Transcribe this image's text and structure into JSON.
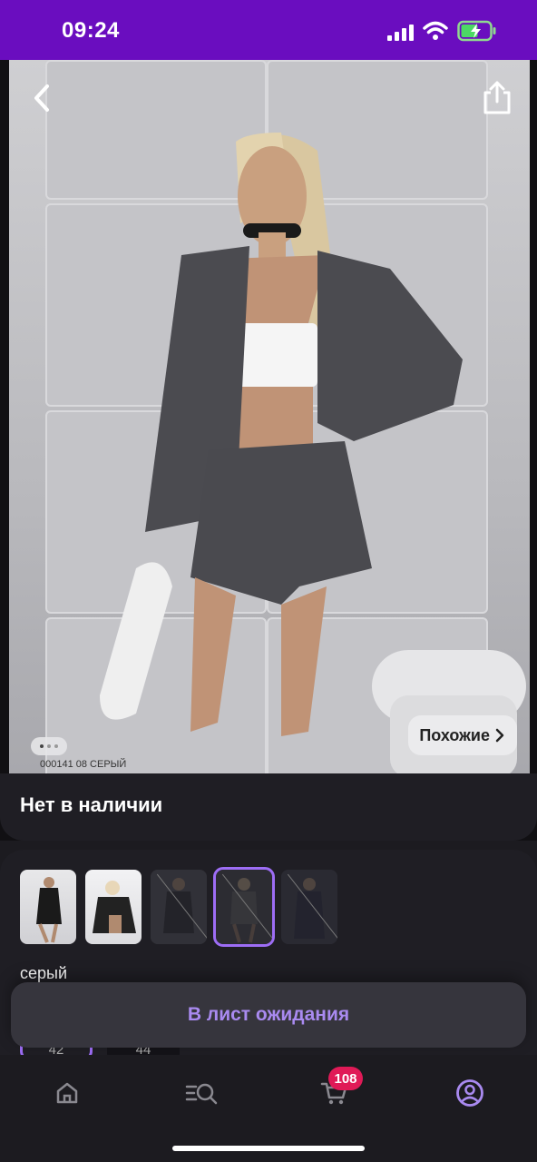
{
  "status_bar": {
    "time": "09:24"
  },
  "product": {
    "similar_label": "Похожие",
    "article_code": "000141 08 СЕРЫЙ",
    "availability": "Нет в наличии"
  },
  "variants": {
    "color_label": "серый",
    "sizes": [
      "42",
      "44"
    ]
  },
  "actions": {
    "waitlist_label": "В лист ожидания"
  },
  "tab_bar": {
    "cart_count": "108"
  },
  "colors": {
    "accent": "#9d6df5",
    "status_bar": "#6a0dbf",
    "badge": "#e01a57"
  }
}
